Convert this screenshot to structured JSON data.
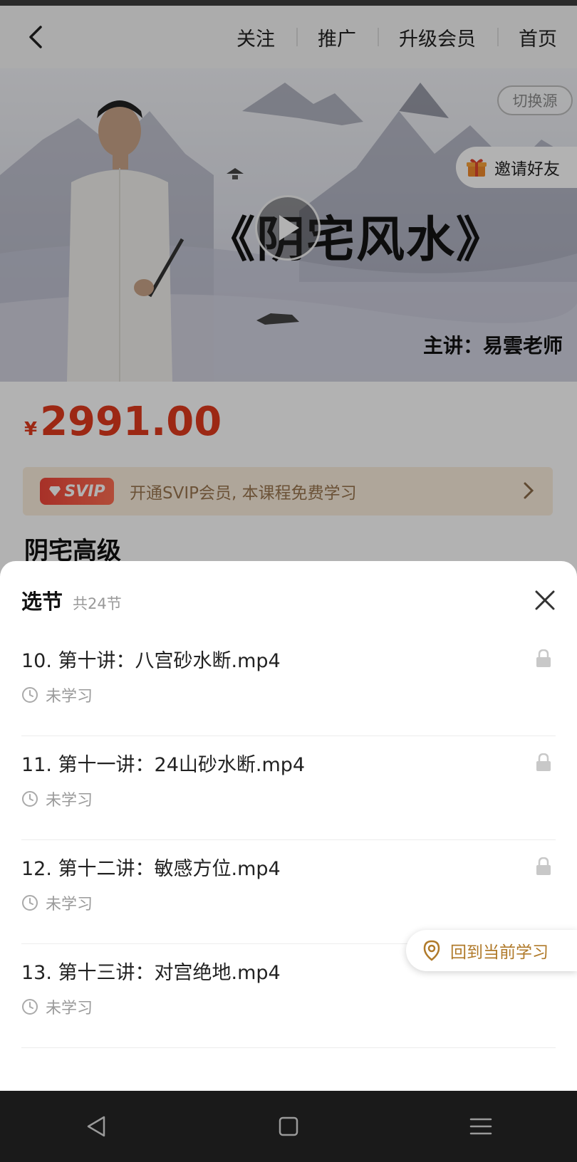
{
  "nav": {
    "items": [
      "关注",
      "推广",
      "升级会员",
      "首页"
    ]
  },
  "banner": {
    "course_title": "《阴宅风水》",
    "lecturer": "主讲：易雲老师",
    "switch_source": "切换源",
    "invite_friends": "邀请好友"
  },
  "price": {
    "symbol": "¥",
    "value": "2991.00"
  },
  "svip": {
    "badge": "SVIP",
    "text": "开通SVIP会员, 本课程免费学习"
  },
  "course_name": "阴宅高级",
  "sheet": {
    "title": "选节",
    "count": "共24节",
    "back_to_current": "回到当前学习",
    "lessons": [
      {
        "title": "10. 第十讲：八宫砂水断.mp4",
        "status": "未学习"
      },
      {
        "title": "11. 第十一讲：24山砂水断.mp4",
        "status": "未学习"
      },
      {
        "title": "12. 第十二讲：敏感方位.mp4",
        "status": "未学习"
      },
      {
        "title": "13. 第十三讲：对宫绝地.mp4",
        "status": "未学习"
      }
    ]
  },
  "colors": {
    "price_red": "#e03a1d",
    "svip_bg": "#fbeedd",
    "accent_gold": "#b07a2a"
  }
}
